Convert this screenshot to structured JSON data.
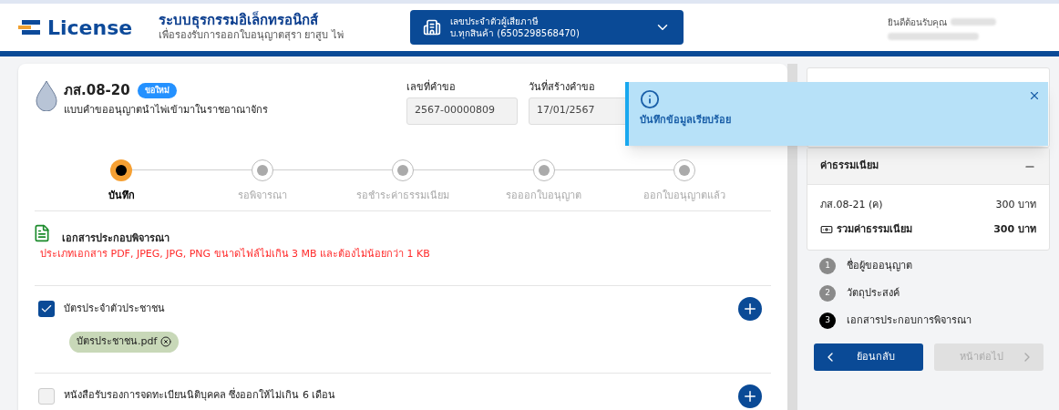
{
  "header": {
    "logo_text": "License",
    "title": "ระบบธุรกรรมอิเล็กทรอนิกส์",
    "subtitle": "เพื่อรองรับการออกใบอนุญาตสุรา ยาสูบ ไพ่",
    "taxpayer": {
      "label": "เลขประจำตัวผู้เสียภาษี",
      "value": "บ.ทุกสินค้า (6505298568470)"
    },
    "welcome": "ยินดีต้อนรับคุณ"
  },
  "form": {
    "code": "ภส.08-20",
    "badge": "ขอใหม่",
    "description": "แบบคำขออนุญาตนำไพ่เข้ามาในราชอาณาจักร",
    "fields": [
      {
        "label": "เลขที่คำขอ",
        "value": "2567-00000809"
      },
      {
        "label": "วันที่สร้างคำขอ",
        "value": "17/01/2567"
      }
    ]
  },
  "progress": [
    {
      "label": "บันทึก",
      "selected": true
    },
    {
      "label": "รอพิจารณา",
      "selected": false
    },
    {
      "label": "รอชำระค่าธรรมเนียม",
      "selected": false
    },
    {
      "label": "รอออกใบอนุญาต",
      "selected": false
    },
    {
      "label": "ออกใบอนุญาตแล้ว",
      "selected": false
    }
  ],
  "documents": {
    "title": "เอกสารประกอบพิจารณา",
    "note": "ประเภทเอกสาร PDF, JPEG, JPG, PNG ขนาดไฟล์ไม่เกิน 3 MB และต้องไม่น้อยกว่า 1 KB",
    "items": [
      {
        "label": "บัตรประจำตัวประชาชน",
        "checked": true,
        "files": [
          "บัตรประชาชน.pdf"
        ]
      },
      {
        "label": "หนังสือรับรองการจดทะเบียนนิติบุคคล ซึ่งออกให้ไม่เกิน 6 เดือน",
        "checked": false
      }
    ]
  },
  "sidebar": {
    "fees": {
      "title": "ค่าธรรมเนียม",
      "expanded": true,
      "items": [
        {
          "name": "ภส.08-21 (ค)",
          "amount": "300 บาท"
        }
      ],
      "total_label": "รวมค่าธรรมเนียม",
      "total": "300 บาท"
    },
    "steps": [
      {
        "number": "1",
        "label": "ชื่อผู้ขออนุญาต",
        "selected": false
      },
      {
        "number": "2",
        "label": "วัตถุประสงค์",
        "selected": false
      },
      {
        "number": "3",
        "label": "เอกสารประกอบการพิจารณา",
        "selected": true
      }
    ],
    "back": {
      "label": "ย้อนกลับ",
      "disabled": false
    },
    "next": {
      "label": "หน้าต่อไป",
      "disabled": true
    }
  },
  "toast": {
    "message": "บันทึกข้อมูลเรียบร้อย"
  }
}
